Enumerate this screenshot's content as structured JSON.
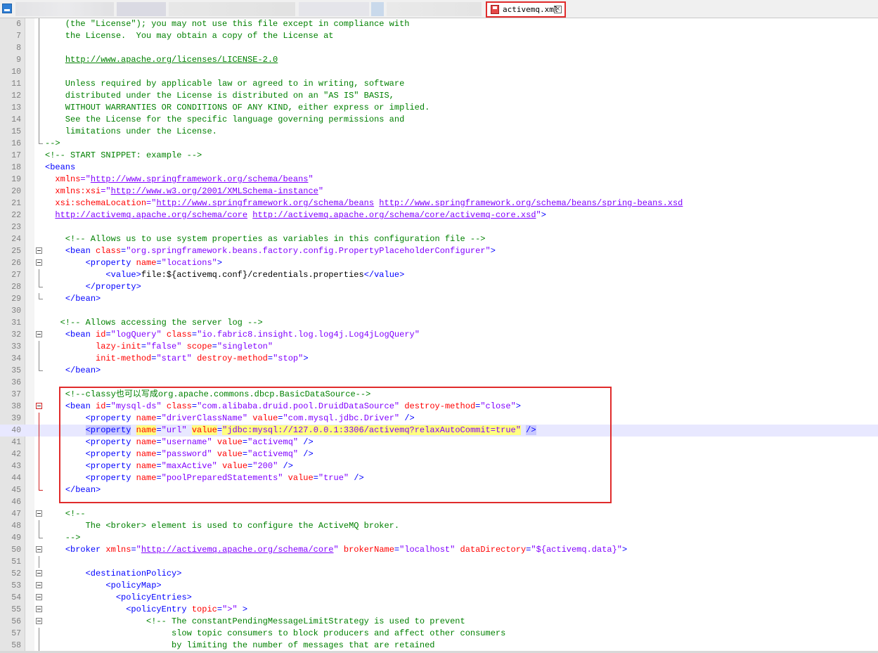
{
  "tab": {
    "label": "activemq.xml",
    "close": "×"
  },
  "lines": [
    {
      "n": "6",
      "fold": "line",
      "segs": [
        {
          "t": "    (the \"License\"); you may not use this file except in compliance with",
          "c": "cmt"
        }
      ]
    },
    {
      "n": "7",
      "fold": "line",
      "segs": [
        {
          "t": "    the License.  You may obtain a copy of the License at",
          "c": "cmt"
        }
      ]
    },
    {
      "n": "8",
      "fold": "line",
      "segs": []
    },
    {
      "n": "9",
      "fold": "line",
      "segs": [
        {
          "t": "    ",
          "c": "cmt"
        },
        {
          "t": "http://www.apache.org/licenses/LICENSE-2.0",
          "c": "cmt u"
        }
      ]
    },
    {
      "n": "10",
      "fold": "line",
      "segs": []
    },
    {
      "n": "11",
      "fold": "line",
      "segs": [
        {
          "t": "    Unless required by applicable law or agreed to in writing, software",
          "c": "cmt"
        }
      ]
    },
    {
      "n": "12",
      "fold": "line",
      "segs": [
        {
          "t": "    distributed under the License is distributed on an \"AS IS\" BASIS,",
          "c": "cmt"
        }
      ]
    },
    {
      "n": "13",
      "fold": "line",
      "segs": [
        {
          "t": "    WITHOUT WARRANTIES OR CONDITIONS OF ANY KIND, either express or implied.",
          "c": "cmt"
        }
      ]
    },
    {
      "n": "14",
      "fold": "line",
      "segs": [
        {
          "t": "    See the License for the specific language governing permissions and",
          "c": "cmt"
        }
      ]
    },
    {
      "n": "15",
      "fold": "line",
      "segs": [
        {
          "t": "    limitations under the License.",
          "c": "cmt"
        }
      ]
    },
    {
      "n": "16",
      "fold": "end",
      "segs": [
        {
          "t": "-->",
          "c": "cmt"
        }
      ]
    },
    {
      "n": "17",
      "fold": "",
      "segs": [
        {
          "t": "<!-- START SNIPPET: example -->",
          "c": "cmt"
        }
      ]
    },
    {
      "n": "18",
      "fold": "",
      "segs": [
        {
          "t": "<beans",
          "c": "tag"
        }
      ]
    },
    {
      "n": "19",
      "fold": "",
      "segs": [
        {
          "t": "  "
        },
        {
          "t": "xmlns",
          "c": "attr"
        },
        {
          "t": "=\"",
          "c": "val"
        },
        {
          "t": "http://www.springframework.org/schema/beans",
          "c": "url"
        },
        {
          "t": "\"",
          "c": "val"
        }
      ]
    },
    {
      "n": "20",
      "fold": "",
      "segs": [
        {
          "t": "  "
        },
        {
          "t": "xmlns:xsi",
          "c": "attr"
        },
        {
          "t": "=\"",
          "c": "val"
        },
        {
          "t": "http://www.w3.org/2001/XMLSchema-instance",
          "c": "url"
        },
        {
          "t": "\"",
          "c": "val"
        }
      ]
    },
    {
      "n": "21",
      "fold": "",
      "segs": [
        {
          "t": "  "
        },
        {
          "t": "xsi:schemaLocation",
          "c": "attr"
        },
        {
          "t": "=\"",
          "c": "val"
        },
        {
          "t": "http://www.springframework.org/schema/beans",
          "c": "url"
        },
        {
          "t": " "
        },
        {
          "t": "http://www.springframework.org/schema/beans/spring-beans.xsd",
          "c": "url"
        }
      ]
    },
    {
      "n": "22",
      "fold": "",
      "segs": [
        {
          "t": "  "
        },
        {
          "t": "http://activemq.apache.org/schema/core",
          "c": "url"
        },
        {
          "t": " "
        },
        {
          "t": "http://activemq.apache.org/schema/core/activemq-core.xsd",
          "c": "url"
        },
        {
          "t": "\"",
          "c": "val"
        },
        {
          "t": ">",
          "c": "tag"
        }
      ]
    },
    {
      "n": "23",
      "fold": "",
      "segs": []
    },
    {
      "n": "24",
      "fold": "",
      "segs": [
        {
          "t": "    <!-- Allows us to use system properties as variables in this configuration file -->",
          "c": "cmt"
        }
      ]
    },
    {
      "n": "25",
      "fold": "box",
      "segs": [
        {
          "t": "    "
        },
        {
          "t": "<bean ",
          "c": "tag"
        },
        {
          "t": "class",
          "c": "attr"
        },
        {
          "t": "=",
          "c": "tag"
        },
        {
          "t": "\"org.springframework.beans.factory.config.PropertyPlaceholderConfigurer\"",
          "c": "val"
        },
        {
          "t": ">",
          "c": "tag"
        }
      ]
    },
    {
      "n": "26",
      "fold": "box",
      "segs": [
        {
          "t": "        "
        },
        {
          "t": "<property ",
          "c": "tag"
        },
        {
          "t": "name",
          "c": "attr"
        },
        {
          "t": "=",
          "c": "tag"
        },
        {
          "t": "\"locations\"",
          "c": "val"
        },
        {
          "t": ">",
          "c": "tag"
        }
      ]
    },
    {
      "n": "27",
      "fold": "line",
      "segs": [
        {
          "t": "            "
        },
        {
          "t": "<value>",
          "c": "tag"
        },
        {
          "t": "file:${activemq.conf}/credentials.properties",
          "c": "txtc"
        },
        {
          "t": "</value>",
          "c": "tag"
        }
      ]
    },
    {
      "n": "28",
      "fold": "end",
      "segs": [
        {
          "t": "        "
        },
        {
          "t": "</property>",
          "c": "tag"
        }
      ]
    },
    {
      "n": "29",
      "fold": "end",
      "segs": [
        {
          "t": "    "
        },
        {
          "t": "</bean>",
          "c": "tag"
        }
      ]
    },
    {
      "n": "30",
      "fold": "",
      "segs": []
    },
    {
      "n": "31",
      "fold": "",
      "segs": [
        {
          "t": "   <!-- Allows accessing the server log -->",
          "c": "cmt"
        }
      ]
    },
    {
      "n": "32",
      "fold": "box",
      "segs": [
        {
          "t": "    "
        },
        {
          "t": "<bean ",
          "c": "tag"
        },
        {
          "t": "id",
          "c": "attr"
        },
        {
          "t": "=",
          "c": "tag"
        },
        {
          "t": "\"logQuery\"",
          "c": "val"
        },
        {
          "t": " "
        },
        {
          "t": "class",
          "c": "attr"
        },
        {
          "t": "=",
          "c": "tag"
        },
        {
          "t": "\"io.fabric8.insight.log.log4j.Log4jLogQuery\"",
          "c": "val"
        }
      ]
    },
    {
      "n": "33",
      "fold": "line",
      "segs": [
        {
          "t": "          "
        },
        {
          "t": "lazy-init",
          "c": "attr"
        },
        {
          "t": "=",
          "c": "tag"
        },
        {
          "t": "\"false\"",
          "c": "val"
        },
        {
          "t": " "
        },
        {
          "t": "scope",
          "c": "attr"
        },
        {
          "t": "=",
          "c": "tag"
        },
        {
          "t": "\"singleton\"",
          "c": "val"
        }
      ]
    },
    {
      "n": "34",
      "fold": "line",
      "segs": [
        {
          "t": "          "
        },
        {
          "t": "init-method",
          "c": "attr"
        },
        {
          "t": "=",
          "c": "tag"
        },
        {
          "t": "\"start\"",
          "c": "val"
        },
        {
          "t": " "
        },
        {
          "t": "destroy-method",
          "c": "attr"
        },
        {
          "t": "=",
          "c": "tag"
        },
        {
          "t": "\"stop\"",
          "c": "val"
        },
        {
          "t": ">",
          "c": "tag"
        }
      ]
    },
    {
      "n": "35",
      "fold": "end",
      "segs": [
        {
          "t": "    "
        },
        {
          "t": "</bean>",
          "c": "tag"
        }
      ]
    },
    {
      "n": "36",
      "fold": "",
      "segs": []
    },
    {
      "n": "37",
      "fold": "",
      "segs": [
        {
          "t": "    <!--classy也可以写成org.apache.commons.dbcp.BasicDataSource-->",
          "c": "cmt"
        }
      ]
    },
    {
      "n": "38",
      "fold": "boxred",
      "segs": [
        {
          "t": "    "
        },
        {
          "t": "<bean ",
          "c": "tag"
        },
        {
          "t": "id",
          "c": "attr"
        },
        {
          "t": "=",
          "c": "tag"
        },
        {
          "t": "\"mysql-ds\"",
          "c": "val"
        },
        {
          "t": " "
        },
        {
          "t": "class",
          "c": "attr"
        },
        {
          "t": "=",
          "c": "tag"
        },
        {
          "t": "\"com.alibaba.druid.pool.DruidDataSource\"",
          "c": "val"
        },
        {
          "t": " "
        },
        {
          "t": "destroy-method",
          "c": "attr"
        },
        {
          "t": "=",
          "c": "tag"
        },
        {
          "t": "\"close\"",
          "c": "val"
        },
        {
          "t": ">",
          "c": "tag"
        }
      ]
    },
    {
      "n": "39",
      "fold": "linered",
      "segs": [
        {
          "t": "        "
        },
        {
          "t": "<property ",
          "c": "tag"
        },
        {
          "t": "name",
          "c": "attr"
        },
        {
          "t": "=",
          "c": "tag"
        },
        {
          "t": "\"driverClassName\"",
          "c": "val"
        },
        {
          "t": " "
        },
        {
          "t": "value",
          "c": "attr"
        },
        {
          "t": "=",
          "c": "tag"
        },
        {
          "t": "\"com.mysql.jdbc.Driver\"",
          "c": "val"
        },
        {
          "t": " "
        },
        {
          "t": "/>",
          "c": "tag"
        }
      ]
    },
    {
      "n": "40",
      "fold": "linered",
      "current": true,
      "segs": [
        {
          "t": "        "
        },
        {
          "t": "<property",
          "c": "tag hlt"
        },
        {
          "t": " "
        },
        {
          "t": "name",
          "c": "attr hlw"
        },
        {
          "t": "=",
          "c": "tag"
        },
        {
          "t": "\"url\"",
          "c": "val"
        },
        {
          "t": " "
        },
        {
          "t": "value",
          "c": "attr hlw"
        },
        {
          "t": "=",
          "c": "tag"
        },
        {
          "t": "\"jdbc:mysql://127.0.0.1:3306",
          "c": "val hlw"
        },
        {
          "t": "",
          "c": "caret"
        },
        {
          "t": "/activemq?relaxAutoCommit=true\"",
          "c": "val hlw"
        },
        {
          "t": " "
        },
        {
          "t": "/>",
          "c": "tag hlt"
        }
      ]
    },
    {
      "n": "41",
      "fold": "linered",
      "segs": [
        {
          "t": "        "
        },
        {
          "t": "<property ",
          "c": "tag"
        },
        {
          "t": "name",
          "c": "attr"
        },
        {
          "t": "=",
          "c": "tag"
        },
        {
          "t": "\"username\"",
          "c": "val"
        },
        {
          "t": " "
        },
        {
          "t": "value",
          "c": "attr"
        },
        {
          "t": "=",
          "c": "tag"
        },
        {
          "t": "\"activemq\"",
          "c": "val"
        },
        {
          "t": " "
        },
        {
          "t": "/>",
          "c": "tag"
        }
      ]
    },
    {
      "n": "42",
      "fold": "linered",
      "segs": [
        {
          "t": "        "
        },
        {
          "t": "<property ",
          "c": "tag"
        },
        {
          "t": "name",
          "c": "attr"
        },
        {
          "t": "=",
          "c": "tag"
        },
        {
          "t": "\"password\"",
          "c": "val"
        },
        {
          "t": " "
        },
        {
          "t": "value",
          "c": "attr"
        },
        {
          "t": "=",
          "c": "tag"
        },
        {
          "t": "\"activemq\"",
          "c": "val"
        },
        {
          "t": " "
        },
        {
          "t": "/>",
          "c": "tag"
        }
      ]
    },
    {
      "n": "43",
      "fold": "linered",
      "segs": [
        {
          "t": "        "
        },
        {
          "t": "<property ",
          "c": "tag"
        },
        {
          "t": "name",
          "c": "attr"
        },
        {
          "t": "=",
          "c": "tag"
        },
        {
          "t": "\"maxActive\"",
          "c": "val"
        },
        {
          "t": " "
        },
        {
          "t": "value",
          "c": "attr"
        },
        {
          "t": "=",
          "c": "tag"
        },
        {
          "t": "\"200\"",
          "c": "val"
        },
        {
          "t": " "
        },
        {
          "t": "/>",
          "c": "tag"
        }
      ]
    },
    {
      "n": "44",
      "fold": "linered",
      "segs": [
        {
          "t": "        "
        },
        {
          "t": "<property ",
          "c": "tag"
        },
        {
          "t": "name",
          "c": "attr"
        },
        {
          "t": "=",
          "c": "tag"
        },
        {
          "t": "\"poolPreparedStatements\"",
          "c": "val"
        },
        {
          "t": " "
        },
        {
          "t": "value",
          "c": "attr"
        },
        {
          "t": "=",
          "c": "tag"
        },
        {
          "t": "\"true\"",
          "c": "val"
        },
        {
          "t": " "
        },
        {
          "t": "/>",
          "c": "tag"
        }
      ]
    },
    {
      "n": "45",
      "fold": "endred",
      "segs": [
        {
          "t": "    "
        },
        {
          "t": "</bean>",
          "c": "tag"
        }
      ]
    },
    {
      "n": "46",
      "fold": "",
      "segs": []
    },
    {
      "n": "47",
      "fold": "box",
      "segs": [
        {
          "t": "    <!--",
          "c": "cmt"
        }
      ]
    },
    {
      "n": "48",
      "fold": "line",
      "segs": [
        {
          "t": "        The <broker> element is used to configure the ActiveMQ broker.",
          "c": "cmt"
        }
      ]
    },
    {
      "n": "49",
      "fold": "end",
      "segs": [
        {
          "t": "    -->",
          "c": "cmt"
        }
      ]
    },
    {
      "n": "50",
      "fold": "box",
      "segs": [
        {
          "t": "    "
        },
        {
          "t": "<broker ",
          "c": "tag"
        },
        {
          "t": "xmlns",
          "c": "attr"
        },
        {
          "t": "=",
          "c": "tag"
        },
        {
          "t": "\"",
          "c": "val"
        },
        {
          "t": "http://activemq.apache.org/schema/core",
          "c": "url"
        },
        {
          "t": "\"",
          "c": "val"
        },
        {
          "t": " "
        },
        {
          "t": "brokerName",
          "c": "attr"
        },
        {
          "t": "=",
          "c": "tag"
        },
        {
          "t": "\"localhost\"",
          "c": "val"
        },
        {
          "t": " "
        },
        {
          "t": "dataDirectory",
          "c": "attr"
        },
        {
          "t": "=",
          "c": "tag"
        },
        {
          "t": "\"${activemq.data}\"",
          "c": "val"
        },
        {
          "t": ">",
          "c": "tag"
        }
      ]
    },
    {
      "n": "51",
      "fold": "line",
      "segs": []
    },
    {
      "n": "52",
      "fold": "box",
      "segs": [
        {
          "t": "        "
        },
        {
          "t": "<destinationPolicy>",
          "c": "tag"
        }
      ]
    },
    {
      "n": "53",
      "fold": "box",
      "segs": [
        {
          "t": "            "
        },
        {
          "t": "<policyMap>",
          "c": "tag"
        }
      ]
    },
    {
      "n": "54",
      "fold": "box",
      "segs": [
        {
          "t": "              "
        },
        {
          "t": "<policyEntries>",
          "c": "tag"
        }
      ]
    },
    {
      "n": "55",
      "fold": "box",
      "segs": [
        {
          "t": "                "
        },
        {
          "t": "<policyEntry ",
          "c": "tag"
        },
        {
          "t": "topic",
          "c": "attr"
        },
        {
          "t": "=",
          "c": "tag"
        },
        {
          "t": "\">\"",
          "c": "val"
        },
        {
          "t": " "
        },
        {
          "t": ">",
          "c": "tag"
        }
      ]
    },
    {
      "n": "56",
      "fold": "box",
      "segs": [
        {
          "t": "                    <!-- The constantPendingMessageLimitStrategy is used to prevent",
          "c": "cmt"
        }
      ]
    },
    {
      "n": "57",
      "fold": "line",
      "segs": [
        {
          "t": "                         slow topic consumers to block producers and affect other consumers",
          "c": "cmt"
        }
      ]
    },
    {
      "n": "58",
      "fold": "line",
      "segs": [
        {
          "t": "                         by limiting the number of messages that are retained",
          "c": "cmt"
        }
      ]
    }
  ]
}
